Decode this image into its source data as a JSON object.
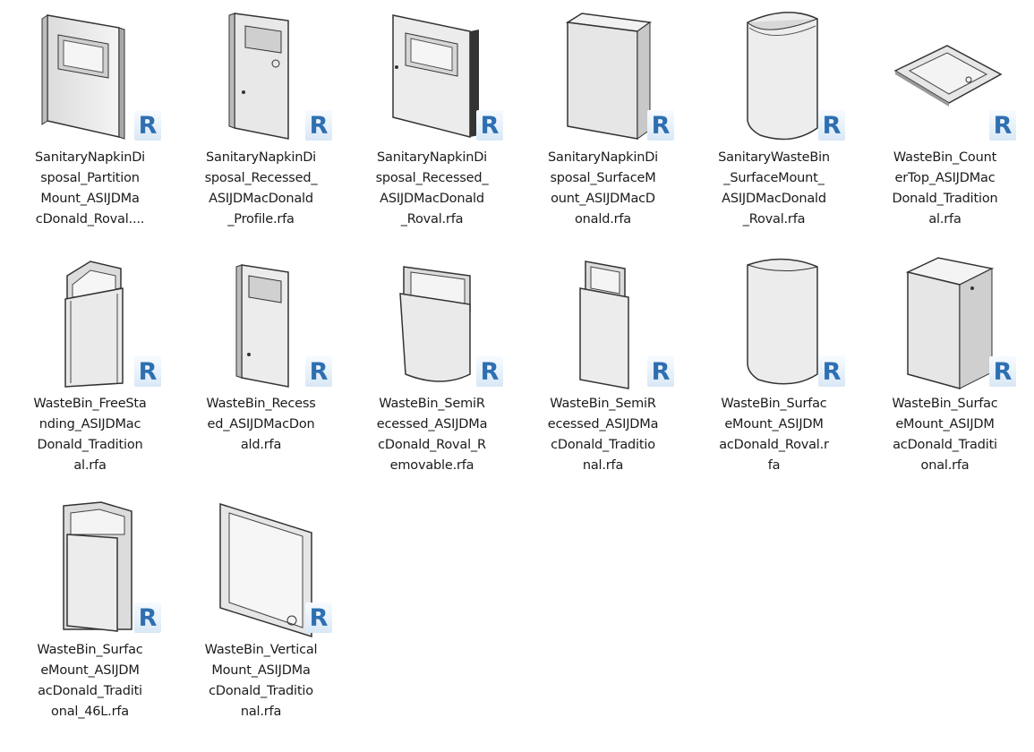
{
  "badge_letter": "R",
  "badge_color": "#2e6fb2",
  "files": [
    {
      "label": "SanitaryNapkinDi\nsposal_Partition\nMount_ASIJDMa\ncDonald_Roval....",
      "icon": "partition-dispenser"
    },
    {
      "label": "SanitaryNapkinDi\nsposal_Recessed_\nASIJDMacDonald\n_Profile.rfa",
      "icon": "recessed-door-dispenser"
    },
    {
      "label": "SanitaryNapkinDi\nsposal_Recessed_\nASIJDMacDonald\n_Roval.rfa",
      "icon": "recessed-box-dispenser"
    },
    {
      "label": "SanitaryNapkinDi\nsposal_SurfaceM\nount_ASIJDMacD\nonald.rfa",
      "icon": "surface-box"
    },
    {
      "label": "SanitaryWasteBin\n_SurfaceMount_\nASIJDMacDonald\n_Roval.rfa",
      "icon": "surface-oval-bin"
    },
    {
      "label": "WasteBin_Count\nerTop_ASIJDMac\nDonald_Tradition\nal.rfa",
      "icon": "countertop-plate"
    },
    {
      "label": "WasteBin_FreeSta\nnding_ASIJDMac\nDonald_Tradition\nal.rfa",
      "icon": "freestanding-bin"
    },
    {
      "label": "WasteBin_Recess\ned_ASIJDMacDon\nald.rfa",
      "icon": "recessed-tall-bin"
    },
    {
      "label": "WasteBin_SemiR\necessed_ASIJDMa\ncDonald_Roval_R\nemovable.rfa",
      "icon": "semi-recessed-roval"
    },
    {
      "label": "WasteBin_SemiR\necessed_ASIJDMa\ncDonald_Traditio\nnal.rfa",
      "icon": "semi-recessed-traditional"
    },
    {
      "label": "WasteBin_Surfac\neMount_ASIJDM\nacDonald_Roval.r\nfa",
      "icon": "surface-roval-bin"
    },
    {
      "label": "WasteBin_Surfac\neMount_ASIJDM\nacDonald_Traditi\nonal.rfa",
      "icon": "surface-traditional-bin"
    },
    {
      "label": "WasteBin_Surfac\neMount_ASIJDM\nacDonald_Traditi\nonal_46L.rfa",
      "icon": "surface-46l-bin"
    },
    {
      "label": "WasteBin_Vertical\nMount_ASIJDMa\ncDonald_Traditio\nnal.rfa",
      "icon": "vertical-mount-panel"
    }
  ]
}
